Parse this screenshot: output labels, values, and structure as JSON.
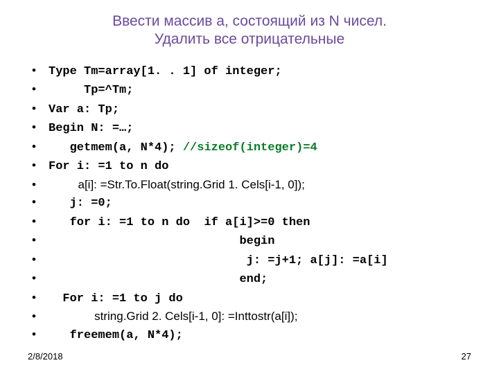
{
  "title_line1": "Ввести массив а, состоящий из N чисел.",
  "title_line2": "Удалить все отрицательные",
  "code": {
    "l1_a": "Type Tm=array[1. . 1] of integer;",
    "l2_a": "     Tp=^Tm;",
    "l3_a": "Var a: Tp;",
    "l4_a": "Begin N: =…;",
    "l5_a": "   getmem(a, N*4); ",
    "l5_b": "//sizeof(integer)=4",
    "l6_a": "For i: =1 to n do",
    "l7_a": "         a[i]: =Str.To.Float(string.Grid 1. Cels[i-1, 0]);",
    "l8_a": "   j: =0;",
    "l9_a": "   for i: =1 to n do  if a[i]>=0 then",
    "l10_a": "                           begin",
    "l11_a": "                            j: =j+1; a[j]: =a[i]",
    "l12_a": "                           end;",
    "l13_a": "  For i: =1 to j do",
    "l14_a": "              string.Grid 2. Cels[i-1, 0]: =Inttostr(a[i]);",
    "l15_a": "   freemem(a, N*4);"
  },
  "footer": {
    "date": "2/8/2018",
    "page": "27"
  }
}
